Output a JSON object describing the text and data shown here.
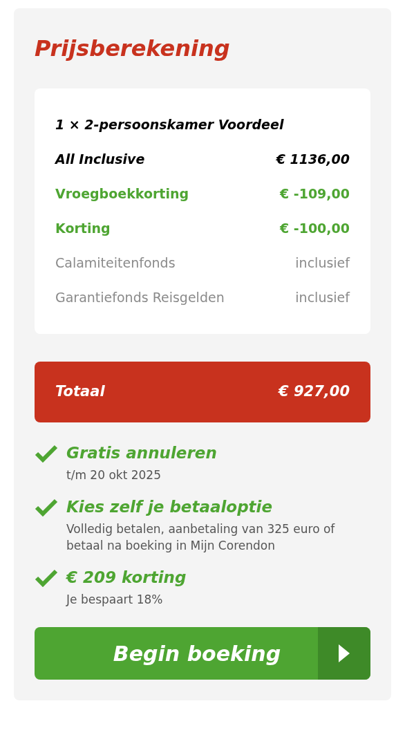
{
  "title": "Prijsberekening",
  "lines": [
    {
      "kind": "item",
      "label": "1 × 2-persoonskamer Voordeel"
    },
    {
      "kind": "item",
      "label": "All Inclusive",
      "amount": "€ 1136,00"
    },
    {
      "kind": "discount",
      "label": "Vroegboekkorting",
      "amount": "€ -109,00"
    },
    {
      "kind": "discount",
      "label": "Korting",
      "amount": "€ -100,00"
    },
    {
      "kind": "info",
      "label": "Calamiteitenfonds",
      "amount": "inclusief"
    },
    {
      "kind": "info",
      "label": "Garantiefonds Reisgelden",
      "amount": "inclusief"
    }
  ],
  "total": {
    "label": "Totaal",
    "amount": "€ 927,00"
  },
  "benefits": [
    {
      "title": "Gratis annuleren",
      "detail": "t/m 20 okt 2025"
    },
    {
      "title": "Kies zelf je betaaloptie",
      "detail": "Volledig betalen, aanbetaling van 325 euro of betaal na boeking in Mijn Corendon"
    },
    {
      "title": "€ 209 korting",
      "detail": "Je bespaart 18%"
    }
  ],
  "button": {
    "label": "Begin boeking"
  }
}
